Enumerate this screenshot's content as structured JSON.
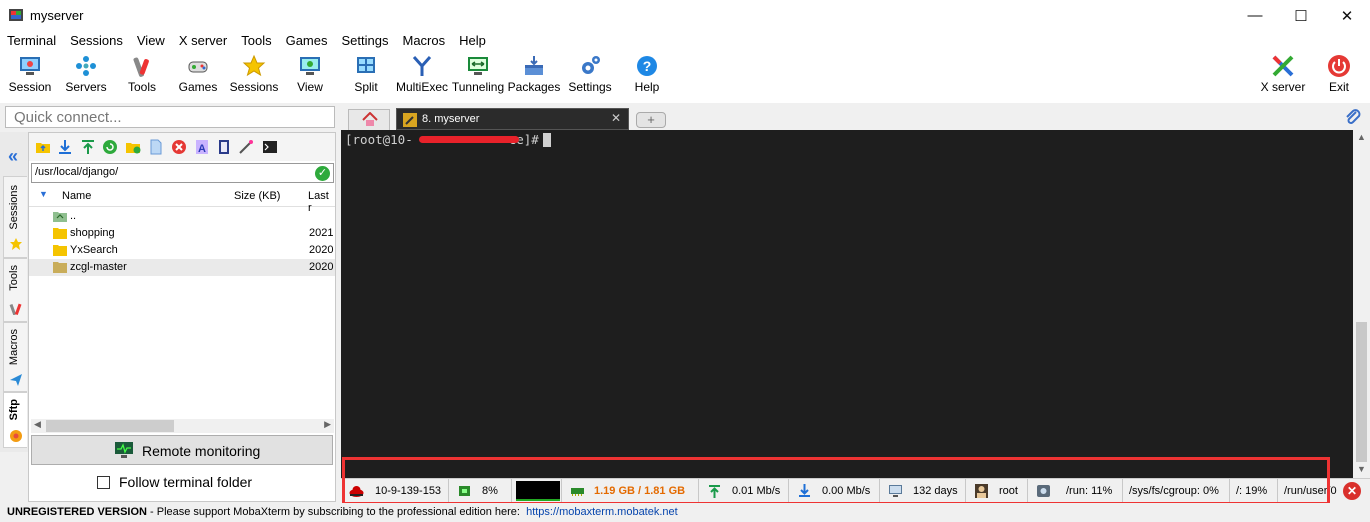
{
  "window": {
    "title": "myserver"
  },
  "menu": [
    "Terminal",
    "Sessions",
    "View",
    "X server",
    "Tools",
    "Games",
    "Settings",
    "Macros",
    "Help"
  ],
  "toolbar": {
    "session": "Session",
    "servers": "Servers",
    "tools": "Tools",
    "games": "Games",
    "sessions": "Sessions",
    "view": "View",
    "split": "Split",
    "multiexec": "MultiExec",
    "tunneling": "Tunneling",
    "packages": "Packages",
    "settings": "Settings",
    "help": "Help",
    "xserver": "X server",
    "exit": "Exit"
  },
  "quick_connect": {
    "placeholder": "Quick connect..."
  },
  "side_tabs": {
    "sessions": "Sessions",
    "tools": "Tools",
    "macros": "Macros",
    "sftp": "Sftp"
  },
  "sftp": {
    "path": "/usr/local/django/",
    "columns": {
      "name": "Name",
      "size": "Size (KB)",
      "modified": "Last r"
    },
    "rows": [
      {
        "name": "..",
        "date": ""
      },
      {
        "name": "shopping",
        "date": "2021"
      },
      {
        "name": "YxSearch",
        "date": "2020"
      },
      {
        "name": "zcgl-master",
        "date": "2020"
      }
    ],
    "remote_monitoring": "Remote monitoring",
    "follow_terminal": "Follow terminal folder"
  },
  "tabs": {
    "active": "8. myserver",
    "plus": "+"
  },
  "terminal": {
    "prompt_start": "[root@10-",
    "prompt_end": "ce]# "
  },
  "status": {
    "host": "10-9-139-153",
    "cpu": "8%",
    "memory": "1.19 GB / 1.81 GB",
    "upload": "0.01 Mb/s",
    "download": "0.00 Mb/s",
    "uptime": "132 days",
    "user": "root",
    "disk1": "/run: 11%",
    "disk2": "/sys/fs/cgroup: 0%",
    "disk3": "/: 19%",
    "disk4": "/run/user/0"
  },
  "colors": {
    "memory_text": "#e46a00",
    "terminal_bg": "#1e1e1e",
    "highlight": "#e33333"
  },
  "footer": {
    "unregistered": "UNREGISTERED VERSION",
    "message": "  -  Please support MobaXterm by subscribing to the professional edition here:",
    "link": "https://mobaxterm.mobatek.net"
  }
}
